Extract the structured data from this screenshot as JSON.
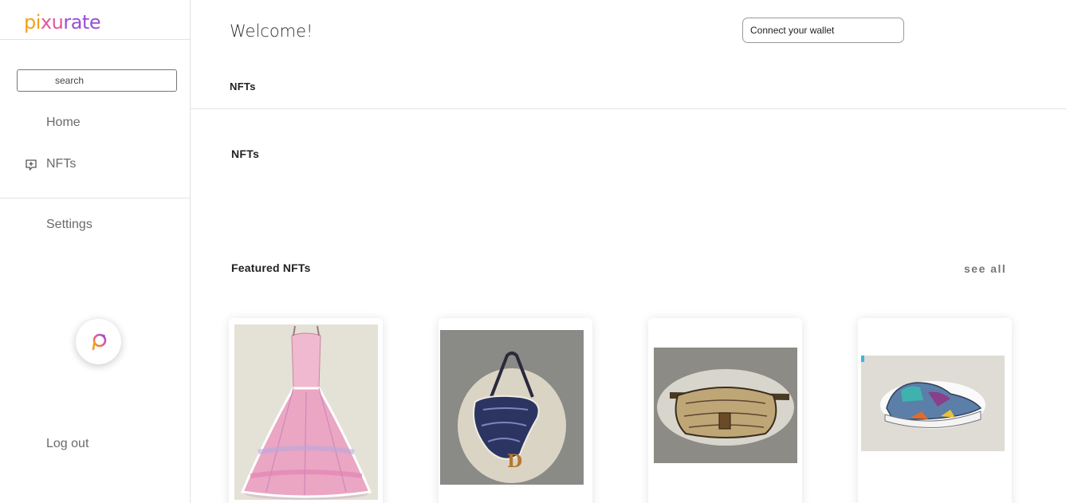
{
  "brand": {
    "name_part1": "pi",
    "name_part2": "xu",
    "name_part3": "rate"
  },
  "sidebar": {
    "search_placeholder": "search",
    "items": [
      {
        "label": "Home",
        "icon": ""
      },
      {
        "label": "NFTs",
        "icon": "nft-badge-icon"
      },
      {
        "label": "Settings",
        "icon": ""
      }
    ],
    "logout_label": "Log out"
  },
  "header": {
    "welcome": "Welcome!",
    "wallet_button": "Connect your wallet",
    "tab": "NFTs"
  },
  "main": {
    "section_title": "NFTs",
    "featured_title": "Featured NFTs",
    "see_all": "see all",
    "cards": [
      {
        "name": "pink-ball-gown"
      },
      {
        "name": "saddle-bag"
      },
      {
        "name": "belt-bag"
      },
      {
        "name": "sneaker"
      }
    ]
  },
  "colors": {
    "brand_orange": "#f2a11a",
    "brand_pink": "#e4569a",
    "brand_purple": "#9a4fd6"
  }
}
